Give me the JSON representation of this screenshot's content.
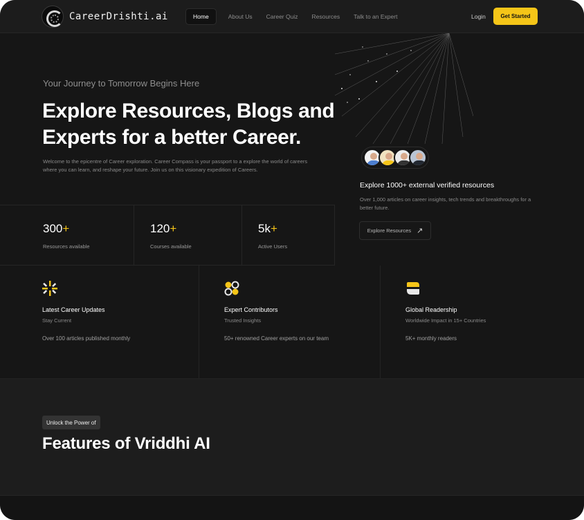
{
  "brand": {
    "name": "CareerDrishti.ai",
    "accent_color": "#f5c518"
  },
  "nav": {
    "links": [
      {
        "label": "Home"
      },
      {
        "label": "About Us"
      },
      {
        "label": "Career Quiz"
      },
      {
        "label": "Resources"
      },
      {
        "label": "Talk to an Expert"
      }
    ],
    "active_index": 0,
    "login_label": "Login",
    "cta_label": "Get Started"
  },
  "hero": {
    "kicker": "Your Journey to Tomorrow Begins Here",
    "title": "Explore Resources, Blogs and Experts for a better Career.",
    "description": "Welcome to the epicentre of Career exploration. Career Compass is your passport to a explore the world of careers where you can learn, and reshape your future. Join us on this visionary expedition of Careers."
  },
  "resources_card": {
    "avatar_count": 4,
    "title": "Explore 1000+ external verified resources",
    "description": "Over 1,000 articles on career insights, tech trends and breakthroughs for a better future.",
    "button_label": "Explore Resources",
    "button_icon": "arrow-up-right-icon"
  },
  "stats": [
    {
      "number": "300",
      "suffix": "+",
      "label": "Resources available"
    },
    {
      "number": "120",
      "suffix": "+",
      "label": "Courses available"
    },
    {
      "number": "5k",
      "suffix": "+",
      "label": "Active Users"
    }
  ],
  "features": [
    {
      "icon": "sparkle-icon",
      "title": "Latest Career Updates",
      "subtitle": "Stay Current",
      "description": "Over 100 articles published monthly"
    },
    {
      "icon": "expert-circles-icon",
      "title": "Expert Contributors",
      "subtitle": "Trusted Insights",
      "description": "50+ renowned Career experts on our team"
    },
    {
      "icon": "globe-leaf-icon",
      "title": "Global Readership",
      "subtitle": "Worldwide Impact in 15+ Countries",
      "description": "5K+ monthly readers"
    }
  ],
  "features_section": {
    "badge": "Unlock the Power of",
    "title": "Features of Vriddhi AI"
  }
}
